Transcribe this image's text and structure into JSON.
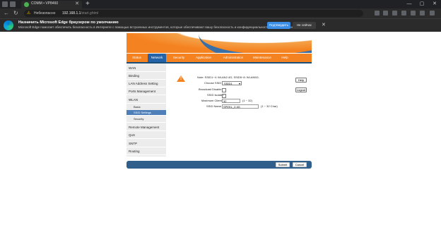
{
  "browser": {
    "tab_title": "COMM • VP8460",
    "tab_close": "✕",
    "new_tab": "+",
    "win_min": "—",
    "win_max": "▢",
    "win_close": "✕",
    "nav_back": "←",
    "nav_reload": "↻",
    "url_warning_icon": "⚠",
    "url_label": "Небезопасно",
    "url_host": "192.168.1.1",
    "url_path": "/start.ghtml"
  },
  "banner": {
    "title": "Назначить Microsoft Edge браузером по умолчанию",
    "text": "Microsoft Edge помогает обеспечить безопасность в Интернете с помощью встроенных инструментов, которые обеспечивают вашу безопасность и конфиденциальность данных просмотра",
    "primary_button": "Подтвердить",
    "secondary_button": "Не сейчас",
    "close": "✕"
  },
  "menu": {
    "items": [
      "Status",
      "Network",
      "Security",
      "Application",
      "Administration",
      "Maintenance",
      "Help"
    ],
    "active": "Network"
  },
  "sidebar": {
    "items": [
      {
        "label": "WAN",
        "sub": false
      },
      {
        "label": "Binding",
        "sub": false
      },
      {
        "label": "LAN Address Setting",
        "sub": false
      },
      {
        "label": "Ports Management",
        "sub": false
      },
      {
        "label": "WLAN",
        "sub": false
      },
      {
        "label": "Basic",
        "sub": true
      },
      {
        "label": "SSID Settings",
        "sub": true,
        "selected": true
      },
      {
        "label": "Security",
        "sub": true
      },
      {
        "label": "Remote Management",
        "sub": false
      },
      {
        "label": "QoS",
        "sub": false
      },
      {
        "label": "SNTP",
        "sub": false
      },
      {
        "label": "Routing",
        "sub": false
      }
    ]
  },
  "form": {
    "note": "Note: SSID1~4: WLAN2.4G; SSID5~8: WLAN5G.",
    "choose_ssid_label": "Choose SSID",
    "choose_ssid_value": "SSID1",
    "broadcast_label": "Broadcast Disable",
    "broadcast_checked": false,
    "ssid_isolate_label": "SSID Isolate",
    "ssid_isolate_checked": true,
    "max_clients_label": "Maximum Clients",
    "max_clients_value": "32",
    "max_clients_hint": "(1 ~ 32)",
    "ssid_name_label": "SSID Name",
    "ssid_name_value": "SPEKL_2.4G",
    "ssid_name_hint": "(1 ~ 32 Char)",
    "warning_icon": "!"
  },
  "side_buttons": {
    "help": "Help",
    "logout": "Logout"
  },
  "footer": {
    "submit": "Submit",
    "cancel": "Cancel"
  },
  "colors": {
    "orange": "#f58220",
    "blue": "#2563a8",
    "footer": "#2f5f8a"
  }
}
